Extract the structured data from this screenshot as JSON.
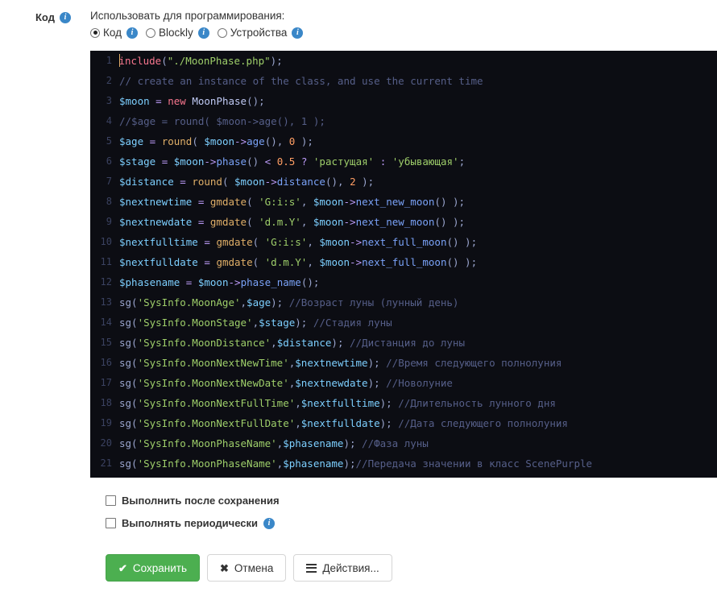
{
  "form": {
    "section_label": "Код",
    "section_info_icon": "info-icon",
    "programming_title": "Использовать для программирования:",
    "mode_options": [
      {
        "label": "Код",
        "selected": true,
        "info_icon": "info-icon"
      },
      {
        "label": "Blockly",
        "selected": false,
        "info_icon": "info-icon"
      },
      {
        "label": "Устройства",
        "selected": false,
        "info_icon": "info-icon"
      }
    ]
  },
  "editor": {
    "language": "php",
    "theme_background": "#0c0d13",
    "gutter_color": "#3b4261",
    "caret_color": "#e0af68",
    "line_count": 21,
    "lines": [
      {
        "n": "1",
        "tokens": [
          {
            "t": "caret",
            "v": ""
          },
          {
            "t": "kw",
            "v": "include"
          },
          {
            "t": "pn",
            "v": "("
          },
          {
            "t": "str",
            "v": "\"./MoonPhase.php\""
          },
          {
            "t": "pn",
            "v": ");"
          }
        ]
      },
      {
        "n": "2",
        "tokens": [
          {
            "t": "com",
            "v": "// create an instance of the class, and use the current time"
          }
        ]
      },
      {
        "n": "3",
        "tokens": [
          {
            "t": "var",
            "v": "$moon"
          },
          {
            "t": "pn",
            "v": " "
          },
          {
            "t": "op",
            "v": "="
          },
          {
            "t": "pn",
            "v": " "
          },
          {
            "t": "kw",
            "v": "new"
          },
          {
            "t": "pn",
            "v": " "
          },
          {
            "t": "cls",
            "v": "MoonPhase"
          },
          {
            "t": "pn",
            "v": "();"
          }
        ]
      },
      {
        "n": "4",
        "tokens": [
          {
            "t": "com",
            "v": "//$age = round( $moon->age(), 1 );"
          }
        ]
      },
      {
        "n": "5",
        "tokens": [
          {
            "t": "var",
            "v": "$age"
          },
          {
            "t": "pn",
            "v": " "
          },
          {
            "t": "op",
            "v": "="
          },
          {
            "t": "pn",
            "v": " "
          },
          {
            "t": "fn",
            "v": "round"
          },
          {
            "t": "pn",
            "v": "( "
          },
          {
            "t": "var",
            "v": "$moon"
          },
          {
            "t": "op",
            "v": "->"
          },
          {
            "t": "meth",
            "v": "age"
          },
          {
            "t": "pn",
            "v": "(), "
          },
          {
            "t": "num",
            "v": "0"
          },
          {
            "t": "pn",
            "v": " );"
          }
        ]
      },
      {
        "n": "6",
        "tokens": [
          {
            "t": "var",
            "v": "$stage"
          },
          {
            "t": "pn",
            "v": " "
          },
          {
            "t": "op",
            "v": "="
          },
          {
            "t": "pn",
            "v": " "
          },
          {
            "t": "var",
            "v": "$moon"
          },
          {
            "t": "op",
            "v": "->"
          },
          {
            "t": "meth",
            "v": "phase"
          },
          {
            "t": "pn",
            "v": "() "
          },
          {
            "t": "op",
            "v": "<"
          },
          {
            "t": "pn",
            "v": " "
          },
          {
            "t": "num",
            "v": "0.5"
          },
          {
            "t": "pn",
            "v": " "
          },
          {
            "t": "op",
            "v": "?"
          },
          {
            "t": "pn",
            "v": " "
          },
          {
            "t": "str",
            "v": "'растущая'"
          },
          {
            "t": "pn",
            "v": " "
          },
          {
            "t": "op",
            "v": ":"
          },
          {
            "t": "pn",
            "v": " "
          },
          {
            "t": "str",
            "v": "'убывающая'"
          },
          {
            "t": "pn",
            "v": ";"
          }
        ]
      },
      {
        "n": "7",
        "tokens": [
          {
            "t": "var",
            "v": "$distance"
          },
          {
            "t": "pn",
            "v": " "
          },
          {
            "t": "op",
            "v": "="
          },
          {
            "t": "pn",
            "v": " "
          },
          {
            "t": "fn",
            "v": "round"
          },
          {
            "t": "pn",
            "v": "( "
          },
          {
            "t": "var",
            "v": "$moon"
          },
          {
            "t": "op",
            "v": "->"
          },
          {
            "t": "meth",
            "v": "distance"
          },
          {
            "t": "pn",
            "v": "(), "
          },
          {
            "t": "num",
            "v": "2"
          },
          {
            "t": "pn",
            "v": " );"
          }
        ]
      },
      {
        "n": "8",
        "tokens": [
          {
            "t": "var",
            "v": "$nextnewtime"
          },
          {
            "t": "pn",
            "v": " "
          },
          {
            "t": "op",
            "v": "="
          },
          {
            "t": "pn",
            "v": " "
          },
          {
            "t": "fn",
            "v": "gmdate"
          },
          {
            "t": "pn",
            "v": "( "
          },
          {
            "t": "str",
            "v": "'G:i:s'"
          },
          {
            "t": "pn",
            "v": ", "
          },
          {
            "t": "var",
            "v": "$moon"
          },
          {
            "t": "op",
            "v": "->"
          },
          {
            "t": "meth",
            "v": "next_new_moon"
          },
          {
            "t": "pn",
            "v": "() );"
          }
        ]
      },
      {
        "n": "9",
        "tokens": [
          {
            "t": "var",
            "v": "$nextnewdate"
          },
          {
            "t": "pn",
            "v": " "
          },
          {
            "t": "op",
            "v": "="
          },
          {
            "t": "pn",
            "v": " "
          },
          {
            "t": "fn",
            "v": "gmdate"
          },
          {
            "t": "pn",
            "v": "( "
          },
          {
            "t": "str",
            "v": "'d.m.Y'"
          },
          {
            "t": "pn",
            "v": ", "
          },
          {
            "t": "var",
            "v": "$moon"
          },
          {
            "t": "op",
            "v": "->"
          },
          {
            "t": "meth",
            "v": "next_new_moon"
          },
          {
            "t": "pn",
            "v": "() );"
          }
        ]
      },
      {
        "n": "10",
        "tokens": [
          {
            "t": "var",
            "v": "$nextfulltime"
          },
          {
            "t": "pn",
            "v": " "
          },
          {
            "t": "op",
            "v": "="
          },
          {
            "t": "pn",
            "v": " "
          },
          {
            "t": "fn",
            "v": "gmdate"
          },
          {
            "t": "pn",
            "v": "( "
          },
          {
            "t": "str",
            "v": "'G:i:s'"
          },
          {
            "t": "pn",
            "v": ", "
          },
          {
            "t": "var",
            "v": "$moon"
          },
          {
            "t": "op",
            "v": "->"
          },
          {
            "t": "meth",
            "v": "next_full_moon"
          },
          {
            "t": "pn",
            "v": "() );"
          }
        ]
      },
      {
        "n": "11",
        "tokens": [
          {
            "t": "var",
            "v": "$nextfulldate"
          },
          {
            "t": "pn",
            "v": " "
          },
          {
            "t": "op",
            "v": "="
          },
          {
            "t": "pn",
            "v": " "
          },
          {
            "t": "fn",
            "v": "gmdate"
          },
          {
            "t": "pn",
            "v": "( "
          },
          {
            "t": "str",
            "v": "'d.m.Y'"
          },
          {
            "t": "pn",
            "v": ", "
          },
          {
            "t": "var",
            "v": "$moon"
          },
          {
            "t": "op",
            "v": "->"
          },
          {
            "t": "meth",
            "v": "next_full_moon"
          },
          {
            "t": "pn",
            "v": "() );"
          }
        ]
      },
      {
        "n": "12",
        "tokens": [
          {
            "t": "var",
            "v": "$phasename"
          },
          {
            "t": "pn",
            "v": " "
          },
          {
            "t": "op",
            "v": "="
          },
          {
            "t": "pn",
            "v": " "
          },
          {
            "t": "var",
            "v": "$moon"
          },
          {
            "t": "op",
            "v": "->"
          },
          {
            "t": "meth",
            "v": "phase_name"
          },
          {
            "t": "pn",
            "v": "();"
          }
        ]
      },
      {
        "n": "13",
        "tokens": [
          {
            "t": "pn",
            "v": "sg("
          },
          {
            "t": "str",
            "v": "'SysInfo.MoonAge'"
          },
          {
            "t": "pn",
            "v": ","
          },
          {
            "t": "var",
            "v": "$age"
          },
          {
            "t": "pn",
            "v": "); "
          },
          {
            "t": "com",
            "v": "//Возраст луны (лунный день)"
          }
        ]
      },
      {
        "n": "14",
        "tokens": [
          {
            "t": "pn",
            "v": "sg("
          },
          {
            "t": "str",
            "v": "'SysInfo.MoonStage'"
          },
          {
            "t": "pn",
            "v": ","
          },
          {
            "t": "var",
            "v": "$stage"
          },
          {
            "t": "pn",
            "v": "); "
          },
          {
            "t": "com",
            "v": "//Стадия луны"
          }
        ]
      },
      {
        "n": "15",
        "tokens": [
          {
            "t": "pn",
            "v": "sg("
          },
          {
            "t": "str",
            "v": "'SysInfo.MoonDistance'"
          },
          {
            "t": "pn",
            "v": ","
          },
          {
            "t": "var",
            "v": "$distance"
          },
          {
            "t": "pn",
            "v": "); "
          },
          {
            "t": "com",
            "v": "//Дистанция до луны"
          }
        ]
      },
      {
        "n": "16",
        "tokens": [
          {
            "t": "pn",
            "v": "sg("
          },
          {
            "t": "str",
            "v": "'SysInfo.MoonNextNewTime'"
          },
          {
            "t": "pn",
            "v": ","
          },
          {
            "t": "var",
            "v": "$nextnewtime"
          },
          {
            "t": "pn",
            "v": "); "
          },
          {
            "t": "com",
            "v": "//Время следующего полнолуния"
          }
        ]
      },
      {
        "n": "17",
        "tokens": [
          {
            "t": "pn",
            "v": "sg("
          },
          {
            "t": "str",
            "v": "'SysInfo.MoonNextNewDate'"
          },
          {
            "t": "pn",
            "v": ","
          },
          {
            "t": "var",
            "v": "$nextnewdate"
          },
          {
            "t": "pn",
            "v": "); "
          },
          {
            "t": "com",
            "v": "//Новолуние"
          }
        ]
      },
      {
        "n": "18",
        "tokens": [
          {
            "t": "pn",
            "v": "sg("
          },
          {
            "t": "str",
            "v": "'SysInfo.MoonNextFullTime'"
          },
          {
            "t": "pn",
            "v": ","
          },
          {
            "t": "var",
            "v": "$nextfulltime"
          },
          {
            "t": "pn",
            "v": "); "
          },
          {
            "t": "com",
            "v": "//Длительность лунного дня"
          }
        ]
      },
      {
        "n": "19",
        "tokens": [
          {
            "t": "pn",
            "v": "sg("
          },
          {
            "t": "str",
            "v": "'SysInfo.MoonNextFullDate'"
          },
          {
            "t": "pn",
            "v": ","
          },
          {
            "t": "var",
            "v": "$nextfulldate"
          },
          {
            "t": "pn",
            "v": "); "
          },
          {
            "t": "com",
            "v": "//Дата следующего полнолуния"
          }
        ]
      },
      {
        "n": "20",
        "tokens": [
          {
            "t": "pn",
            "v": "sg("
          },
          {
            "t": "str",
            "v": "'SysInfo.MoonPhaseName'"
          },
          {
            "t": "pn",
            "v": ","
          },
          {
            "t": "var",
            "v": "$phasename"
          },
          {
            "t": "pn",
            "v": "); "
          },
          {
            "t": "com",
            "v": "//Фаза луны"
          }
        ]
      },
      {
        "n": "21",
        "tokens": [
          {
            "t": "pn",
            "v": "sg("
          },
          {
            "t": "str",
            "v": "'SysInfo.MoonPhaseName'"
          },
          {
            "t": "pn",
            "v": ","
          },
          {
            "t": "var",
            "v": "$phasename"
          },
          {
            "t": "pn",
            "v": ");"
          },
          {
            "t": "com",
            "v": "//Передача значении в класс ScenePurple"
          }
        ]
      }
    ]
  },
  "options": [
    {
      "label": "Выполнить после сохранения",
      "checked": false,
      "has_info": false
    },
    {
      "label": "Выполнять периодически",
      "checked": false,
      "has_info": true,
      "info_icon": "info-icon"
    }
  ],
  "buttons": {
    "save": {
      "label": "Сохранить",
      "icon": "check-icon",
      "glyph": "✔",
      "color": "#4caf50"
    },
    "cancel": {
      "label": "Отмена",
      "icon": "close-icon",
      "glyph": "✖"
    },
    "actions": {
      "label": "Действия...",
      "icon": "hamburger-icon"
    }
  }
}
